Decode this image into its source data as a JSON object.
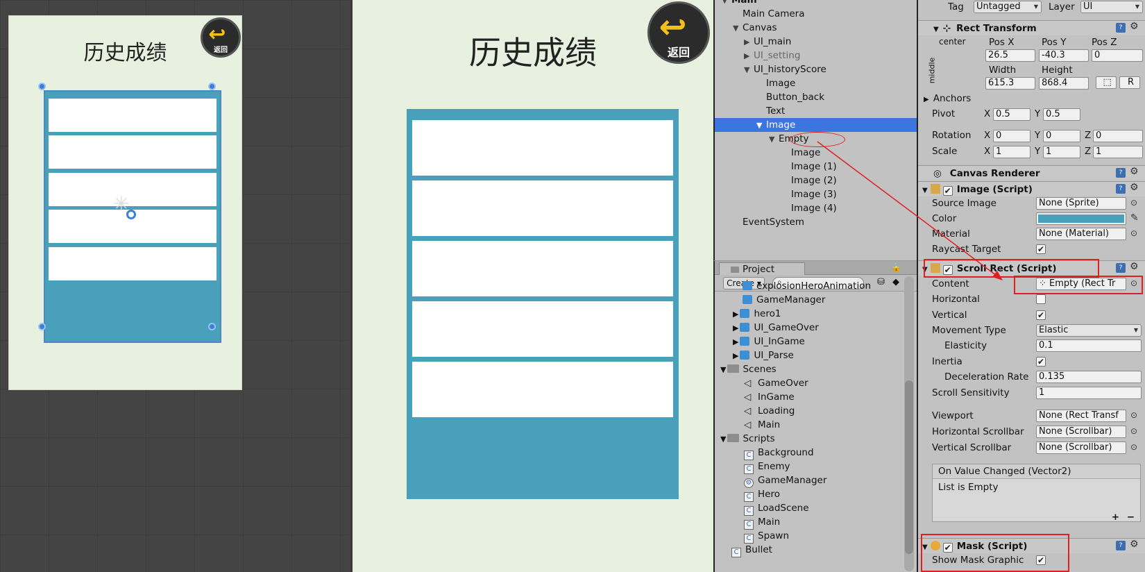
{
  "scene_view": {
    "title": "历史成绩",
    "back_label": "返回",
    "back_arrow": "↩"
  },
  "game_view": {
    "title": "历史成绩",
    "back_label": "返回",
    "back_arrow": "↩"
  },
  "hierarchy": {
    "items": [
      {
        "label": "Main"
      },
      {
        "label": "Main Camera"
      },
      {
        "label": "Canvas"
      },
      {
        "label": "UI_main"
      },
      {
        "label": "UI_setting"
      },
      {
        "label": "UI_historyScore"
      },
      {
        "label": "Image"
      },
      {
        "label": "Button_back"
      },
      {
        "label": "Text"
      },
      {
        "label": "Image"
      },
      {
        "label": "Empty"
      },
      {
        "label": "Image"
      },
      {
        "label": "Image (1)"
      },
      {
        "label": "Image (2)"
      },
      {
        "label": "Image (3)"
      },
      {
        "label": "Image (4)"
      },
      {
        "label": "EventSystem"
      }
    ]
  },
  "project": {
    "tab_label": "Project",
    "create_label": "Create",
    "items": [
      {
        "label": "explosionHeroAnimation",
        "icon": "prefab-icon"
      },
      {
        "label": "GameManager",
        "icon": "prefab-icon"
      },
      {
        "label": "hero1",
        "icon": "prefab-icon"
      },
      {
        "label": "UI_GameOver",
        "icon": "prefab-icon"
      },
      {
        "label": "UI_InGame",
        "icon": "prefab-icon"
      },
      {
        "label": "UI_Parse",
        "icon": "prefab-icon"
      },
      {
        "label": "Scenes",
        "icon": "folder-icon"
      },
      {
        "label": "GameOver",
        "icon": "scene-icon"
      },
      {
        "label": "InGame",
        "icon": "scene-icon"
      },
      {
        "label": "Loading",
        "icon": "scene-icon"
      },
      {
        "label": "Main",
        "icon": "scene-icon"
      },
      {
        "label": "Scripts",
        "icon": "folder-icon"
      },
      {
        "label": "Background",
        "icon": "script-icon"
      },
      {
        "label": "Enemy",
        "icon": "script-icon"
      },
      {
        "label": "GameManager",
        "icon": "gear-script-icon"
      },
      {
        "label": "Hero",
        "icon": "script-icon"
      },
      {
        "label": "LoadScene",
        "icon": "script-icon"
      },
      {
        "label": "Main",
        "icon": "script-icon"
      },
      {
        "label": "Spawn",
        "icon": "script-icon"
      },
      {
        "label": "Bullet",
        "icon": "script-icon"
      }
    ]
  },
  "inspector": {
    "tag_label": "Tag",
    "tag_value": "Untagged",
    "layer_label": "Layer",
    "layer_value": "UI",
    "rect_transform": {
      "title": "Rect Transform",
      "anchor_h": "center",
      "anchor_v": "middle",
      "pos_x_label": "Pos X",
      "pos_x": "26.5",
      "pos_y_label": "Pos Y",
      "pos_y": "-40.3",
      "pos_z_label": "Pos Z",
      "pos_z": "0",
      "width_label": "Width",
      "width": "615.3",
      "height_label": "Height",
      "height": "868.4",
      "r_button": "R",
      "anchors_label": "Anchors",
      "pivot_label": "Pivot",
      "pivot_x": "0.5",
      "pivot_y": "0.5",
      "rotation_label": "Rotation",
      "rot_x": "0",
      "rot_y": "0",
      "rot_z": "0",
      "scale_label": "Scale",
      "scale_x": "1",
      "scale_y": "1",
      "scale_z": "1",
      "x": "X",
      "y": "Y",
      "z": "Z"
    },
    "canvas_renderer": {
      "title": "Canvas Renderer"
    },
    "image_script": {
      "title": "Image (Script)",
      "source_image_label": "Source Image",
      "source_image": "None (Sprite)",
      "color_label": "Color",
      "color": "#48a0bb",
      "material_label": "Material",
      "material": "None (Material)",
      "raycast_label": "Raycast Target"
    },
    "scroll_rect": {
      "title": "Scroll Rect (Script)",
      "content_label": "Content",
      "content": "Empty (Rect Tr",
      "horizontal_label": "Horizontal",
      "vertical_label": "Vertical",
      "movement_label": "Movement Type",
      "movement": "Elastic",
      "elasticity_label": "Elasticity",
      "elasticity": "0.1",
      "inertia_label": "Inertia",
      "decel_label": "Deceleration Rate",
      "decel": "0.135",
      "sensitivity_label": "Scroll Sensitivity",
      "sensitivity": "1",
      "viewport_label": "Viewport",
      "viewport": "None (Rect Transf",
      "hscroll_label": "Horizontal Scrollbar",
      "hscroll": "None (Scrollbar)",
      "vscroll_label": "Vertical Scrollbar",
      "vscroll": "None (Scrollbar)",
      "event_label": "On Value Changed (Vector2)",
      "event_body": "List is Empty",
      "plus": "+",
      "minus": "−"
    },
    "mask": {
      "title": "Mask (Script)",
      "show_label": "Show Mask Graphic"
    }
  },
  "colors": {
    "panel": "#48a0bb",
    "selection": "#3d75e0",
    "annotation": "#e02020"
  }
}
